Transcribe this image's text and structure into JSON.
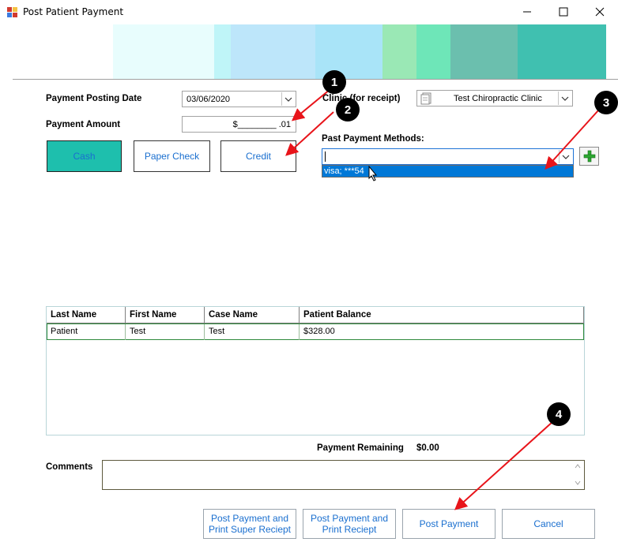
{
  "window": {
    "title": "Post Patient Payment",
    "controls": {
      "minimize": "─",
      "maximize": "☐",
      "close": "✕"
    }
  },
  "banner": {
    "colors": [
      "#e8fdfd",
      "#bff5f8",
      "#bde6fa",
      "#a9e4f8",
      "#9ae8b5",
      "#6ee6b8",
      "#6bbfae",
      "#40c0b0"
    ]
  },
  "form": {
    "posting_date_label": "Payment Posting Date",
    "posting_date_value": "03/06/2020",
    "clinic_label": "Clinic (for receipt)",
    "clinic_value": "Test Chiropractic Clinic",
    "amount_label": "Payment Amount",
    "amount_value": "$________ .01",
    "past_methods_label": "Past Payment Methods:",
    "past_methods_value": "",
    "past_methods_option": "visa; ***54"
  },
  "payment_types": {
    "cash": "Cash",
    "paper_check": "Paper Check",
    "credit": "Credit",
    "selected_color": "#1ebfad"
  },
  "grid": {
    "columns": [
      "Last Name",
      "First Name",
      "Case Name",
      "Patient Balance"
    ],
    "rows": [
      [
        "Patient",
        "Test",
        "Test",
        "$328.00"
      ]
    ]
  },
  "summary": {
    "remaining_label": "Payment Remaining",
    "remaining_value": "$0.00"
  },
  "comments": {
    "label": "Comments",
    "value": ""
  },
  "footer": {
    "post_print_super_line1": "Post Payment and",
    "post_print_super_line2": "Print Super Reciept",
    "post_print_line1": "Post Payment and",
    "post_print_line2": "Print Reciept",
    "post_payment": "Post Payment",
    "cancel": "Cancel"
  },
  "annotations": {
    "markers": [
      "1",
      "2",
      "3",
      "4"
    ],
    "arrow_color": "#e8141a"
  }
}
